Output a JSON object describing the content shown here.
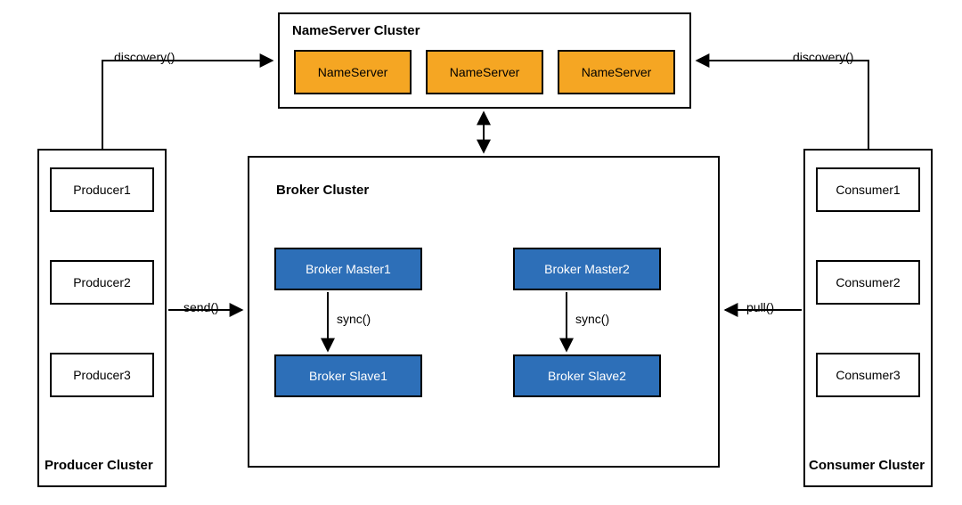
{
  "nameserver_cluster": {
    "title": "NameServer Cluster",
    "nodes": [
      "NameServer",
      "NameServer",
      "NameServer"
    ]
  },
  "broker_cluster": {
    "title": "Broker Cluster",
    "group1": {
      "master": "Broker Master1",
      "slave": "Broker Slave1",
      "sync_label": "sync()"
    },
    "group2": {
      "master": "Broker Master2",
      "slave": "Broker Slave2",
      "sync_label": "sync()"
    }
  },
  "producer_cluster": {
    "title": "Producer Cluster",
    "nodes": [
      "Producer1",
      "Producer2",
      "Producer3"
    ]
  },
  "consumer_cluster": {
    "title": "Consumer Cluster",
    "nodes": [
      "Consumer1",
      "Consumer2",
      "Consumer3"
    ]
  },
  "edges": {
    "producer_discovery": "discovery()",
    "consumer_discovery": "discovery()",
    "send": "send()",
    "pull": "pull()"
  }
}
